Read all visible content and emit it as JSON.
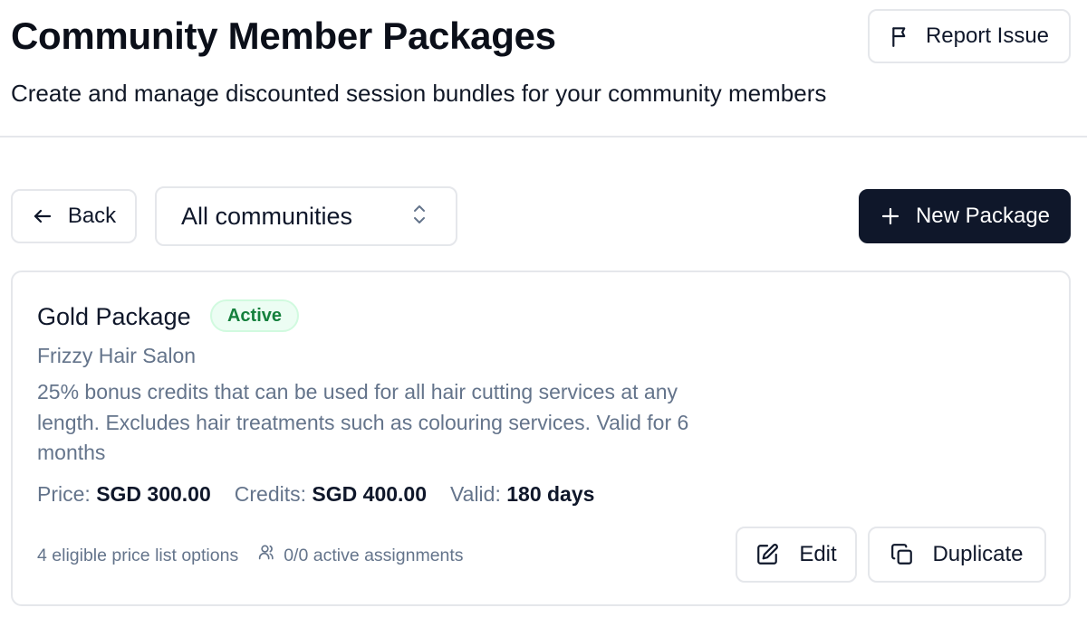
{
  "header": {
    "title": "Community Member Packages",
    "subtitle": "Create and manage discounted session bundles for your community members",
    "report_label": "Report Issue"
  },
  "toolbar": {
    "back_label": "Back",
    "community_select": {
      "value": "All communities"
    },
    "new_package_label": "New Package"
  },
  "packages": [
    {
      "name": "Gold Package",
      "status": "Active",
      "community": "Frizzy Hair Salon",
      "description": "25% bonus credits that can be used for all hair cutting services at any length. Excludes hair treatments such as colouring services. Valid for 6 months",
      "price_label": "Price:",
      "price": "SGD 300.00",
      "credits_label": "Credits:",
      "credits": "SGD 400.00",
      "valid_label": "Valid:",
      "valid": "180 days",
      "eligible_options": "4 eligible price list options",
      "active_assignments": "0/0 active assignments",
      "edit_label": "Edit",
      "duplicate_label": "Duplicate"
    }
  ],
  "icons": {
    "report": "flag-icon",
    "back": "arrow-left-icon",
    "select": "chevron-up-down-icon",
    "new": "plus-icon",
    "assignments": "users-icon",
    "edit": "edit-icon",
    "duplicate": "copy-icon"
  },
  "colors": {
    "primary": "#0f172a",
    "active_badge_bg": "#ecfdf3",
    "active_badge_text": "#15803d",
    "muted_text": "#64748b",
    "border": "#e5e7eb"
  }
}
